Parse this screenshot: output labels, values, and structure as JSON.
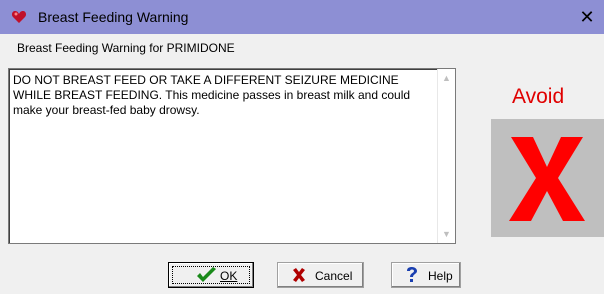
{
  "window": {
    "title": "Breast Feeding Warning",
    "close_glyph": "✕",
    "icon": "heart-icon"
  },
  "subheader": "Breast Feeding Warning for PRIMIDONE",
  "message": "DO NOT BREAST FEED OR TAKE A DIFFERENT SEIZURE MEDICINE WHILE BREAST FEEDING.  This medicine passes in breast milk and could make your breast-fed baby drowsy.",
  "avoid": {
    "label": "Avoid",
    "icon": "red-x-icon",
    "color": "#e00000"
  },
  "buttons": {
    "ok": {
      "label": "OK",
      "icon": "checkmark-icon"
    },
    "cancel": {
      "label": "Cancel",
      "icon": "x-icon"
    },
    "help": {
      "label": "Help",
      "icon": "question-icon"
    }
  },
  "colors": {
    "titlebar": "#8d8fd4",
    "background": "#f0f0f0",
    "avoid_panel": "#bfbfbf"
  }
}
